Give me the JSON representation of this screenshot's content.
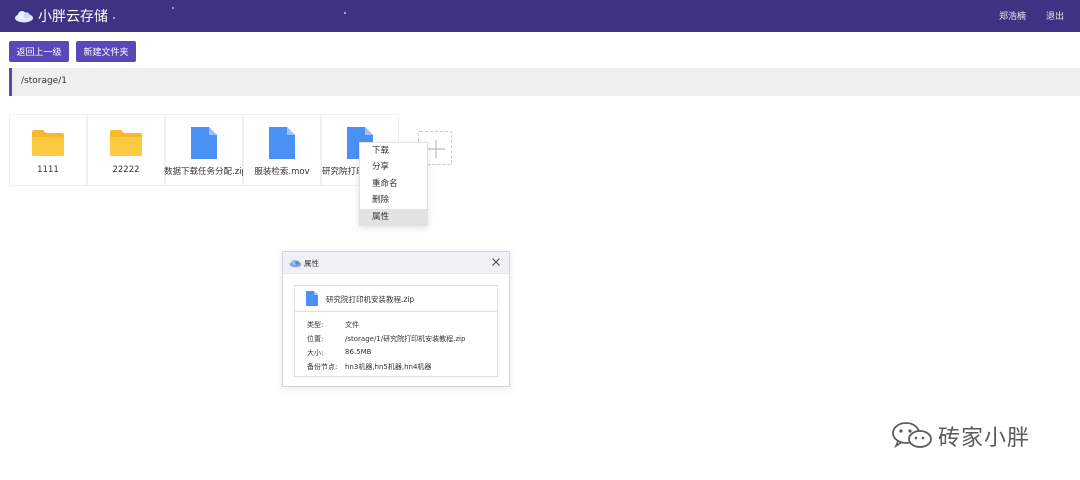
{
  "header": {
    "app_title": "小胖云存储",
    "user_name": "郑浩楠",
    "logout_label": "退出"
  },
  "toolbar": {
    "back_label": "返回上一级",
    "new_folder_label": "新建文件夹"
  },
  "path": "/storage/1",
  "files": [
    {
      "name": "1111",
      "type": "folder"
    },
    {
      "name": "22222",
      "type": "folder"
    },
    {
      "name": "数据下载任务分配.zip",
      "type": "file"
    },
    {
      "name": "服装检索.mov",
      "type": "file"
    },
    {
      "name": "研究院打印",
      "type": "file"
    }
  ],
  "context_menu": {
    "items": [
      "下载",
      "分享",
      "重命名",
      "删除",
      "属性"
    ],
    "active_item": "属性"
  },
  "properties_dialog": {
    "title": "属性",
    "file_name": "研究院打印机安装教程.zip",
    "rows": [
      {
        "key": "类型:",
        "value": "文件"
      },
      {
        "key": "位置:",
        "value": "/storage/1/研究院打印机安装教程.zip"
      },
      {
        "key": "大小:",
        "value": "86.5MB"
      },
      {
        "key": "备份节点:",
        "value": "hn3机器,hn5机器,hn4机器"
      }
    ]
  },
  "watermark": "砖家小胖",
  "colors": {
    "header_bg": "#3d3382",
    "accent": "#5a47b8",
    "folder": "#fcc93f",
    "file": "#4a90f5"
  },
  "icons": {
    "logo": "cloud-icon",
    "folder": "folder-icon",
    "file": "file-icon",
    "add": "plus-icon",
    "close": "close-icon",
    "watermark": "wechat-icon"
  }
}
